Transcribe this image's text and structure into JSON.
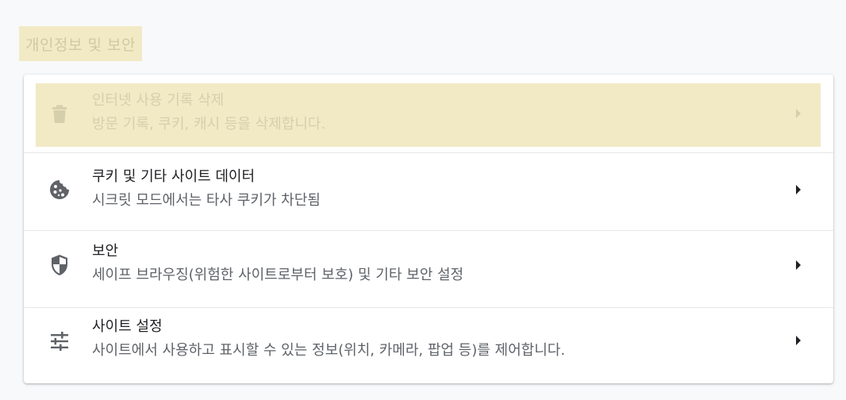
{
  "section": {
    "title": "개인정보 및 보안"
  },
  "rows": [
    {
      "title": "인터넷 사용 기록 삭제",
      "subtitle": "방문 기록, 쿠키, 캐시 등을 삭제합니다.",
      "icon": "trash-icon"
    },
    {
      "title": "쿠키 및 기타 사이트 데이터",
      "subtitle": "시크릿 모드에서는 타사 쿠키가 차단됨",
      "icon": "cookie-icon"
    },
    {
      "title": "보안",
      "subtitle": "세이프 브라우징(위험한 사이트로부터 보호) 및 기타 보안 설정",
      "icon": "shield-icon"
    },
    {
      "title": "사이트 설정",
      "subtitle": "사이트에서 사용하고 표시할 수 있는 정보(위치, 카메라, 팝업 등)를 제어합니다.",
      "icon": "tune-icon"
    }
  ],
  "colors": {
    "highlight": "#f2eac5",
    "highlight_text": "#cfc9a4",
    "icon": "#5f6368",
    "text_primary": "#202124",
    "text_secondary": "#5f6368"
  }
}
